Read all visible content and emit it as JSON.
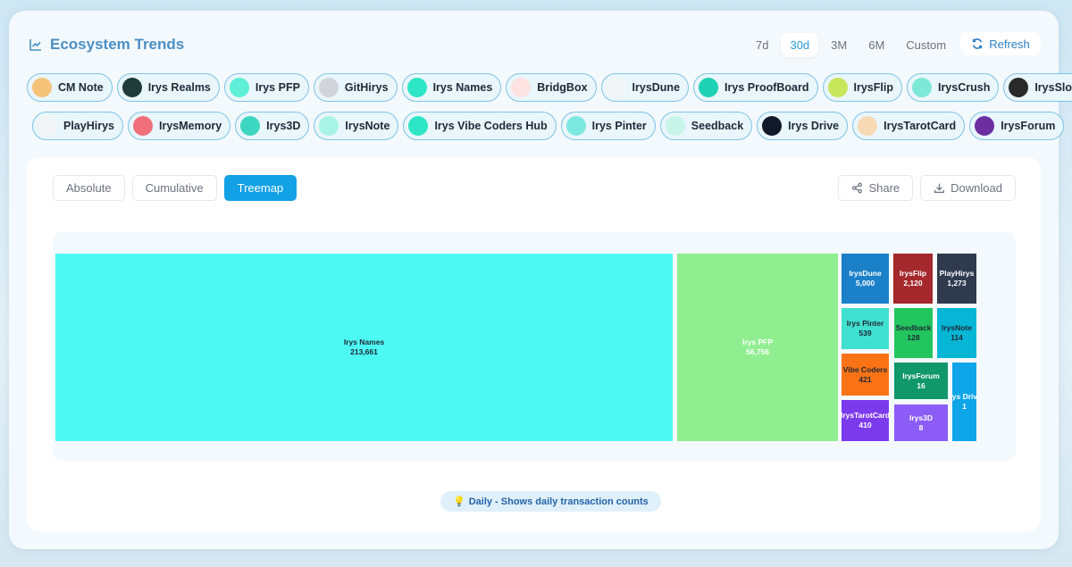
{
  "header": {
    "title": "Ecosystem Trends",
    "ranges": [
      "7d",
      "30d",
      "3M",
      "6M",
      "Custom"
    ],
    "active_range": "30d",
    "refresh": "Refresh"
  },
  "projects_row1": [
    "CM Note",
    "Irys Realms",
    "Irys PFP",
    "GitHirys",
    "Irys Names",
    "BridgBox",
    "IrysDune",
    "Irys ProofBoard",
    "IrysFlip",
    "IrysCrush",
    "IrysSlot"
  ],
  "projects_row2": [
    "PlayHirys",
    "IrysMemory",
    "Irys3D",
    "IrysNote",
    "Irys Vibe Coders Hub",
    "Irys Pinter",
    "Seedback",
    "Irys Drive",
    "IrysTarotCard",
    "IrysForum"
  ],
  "avatar_colors_row1": [
    "#f5c27a",
    "#1f3b3a",
    "#5ef0d8",
    "#d1d5db",
    "#2ee6c6",
    "#fde2e2",
    "#f3f4f6",
    "#1fd1b5",
    "#c8e65a",
    "#7ee8d8",
    "#2a2a2a"
  ],
  "avatar_colors_row2": [
    "#f3f4f6",
    "#ef6f7a",
    "#3dd6c0",
    "#a7f3e4",
    "#2ee6c6",
    "#7de8e0",
    "#c7f5e8",
    "#111827",
    "#f7d9b5",
    "#6b2fa0"
  ],
  "view_tabs": [
    "Absolute",
    "Cumulative",
    "Treemap"
  ],
  "active_view": "Treemap",
  "actions": {
    "share": "Share",
    "download": "Download"
  },
  "chart_data": {
    "type": "treemap",
    "items": [
      {
        "name": "Irys Names",
        "value": "213,661",
        "color": "#4dfaf3",
        "text": "#1f2937"
      },
      {
        "name": "Irys PFP",
        "value": "56,756",
        "color": "#90ee90",
        "text": "#ffffff"
      },
      {
        "name": "IrysDune",
        "value": "5,000",
        "color": "#1a80c8",
        "text": "#ffffff"
      },
      {
        "name": "IrysFlip",
        "value": "2,120",
        "color": "#a4282c",
        "text": "#ffffff"
      },
      {
        "name": "PlayHirys",
        "value": "1,273",
        "color": "#2f3a4f",
        "text": "#ffffff"
      },
      {
        "name": "Irys Pinter",
        "value": "539",
        "color": "#40e0d0",
        "text": "#1f2937"
      },
      {
        "name": "Seedback",
        "value": "128",
        "color": "#22c55e",
        "text": "#1f2937"
      },
      {
        "name": "IrysNote",
        "value": "114",
        "color": "#06b6d4",
        "text": "#1f2937"
      },
      {
        "name": "Vibe Coders",
        "value": "421",
        "color": "#f97316",
        "text": "#1f2937"
      },
      {
        "name": "IrysTarotCard",
        "value": "410",
        "color": "#7c3aed",
        "text": "#ffffff"
      },
      {
        "name": "IrysForum",
        "value": "16",
        "color": "#10986a",
        "text": "#ffffff"
      },
      {
        "name": "Irys3D",
        "value": "8",
        "color": "#8b5cf6",
        "text": "#ffffff"
      },
      {
        "name": "Irys Drive",
        "value": "1",
        "color": "#0ea5e9",
        "text": "#ffffff"
      }
    ]
  },
  "note": "Daily - Shows daily transaction counts"
}
